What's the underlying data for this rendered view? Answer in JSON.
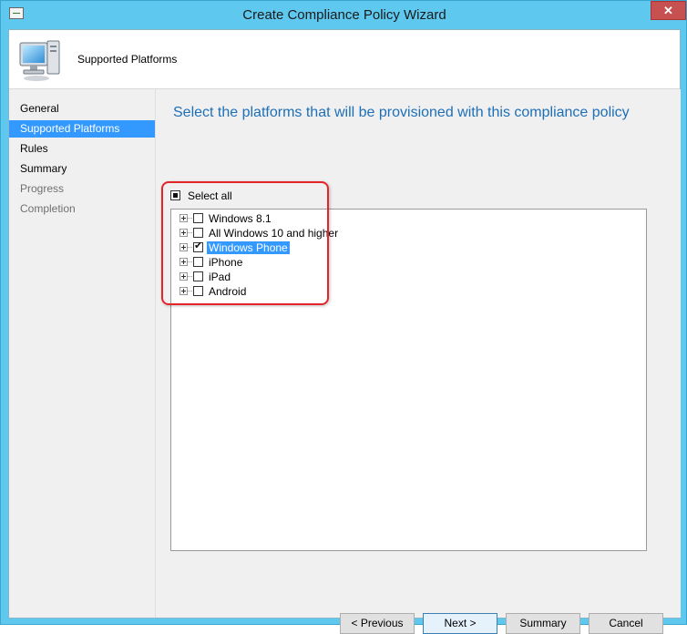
{
  "window": {
    "title": "Create Compliance Policy Wizard",
    "close_glyph": "✕"
  },
  "banner": {
    "title": "Supported Platforms",
    "icon": "computer-icon"
  },
  "nav": {
    "items": [
      {
        "label": "General",
        "state": "normal"
      },
      {
        "label": "Supported Platforms",
        "state": "active"
      },
      {
        "label": "Rules",
        "state": "normal"
      },
      {
        "label": "Summary",
        "state": "normal"
      },
      {
        "label": "Progress",
        "state": "disabled"
      },
      {
        "label": "Completion",
        "state": "disabled"
      }
    ]
  },
  "main": {
    "heading": "Select the platforms that will be provisioned with this compliance policy",
    "select_all": {
      "label": "Select all",
      "state": "indeterminate"
    },
    "platforms": [
      {
        "label": "Windows 8.1",
        "checked": false,
        "selected": false
      },
      {
        "label": "All Windows 10 and higher",
        "checked": false,
        "selected": false
      },
      {
        "label": "Windows Phone",
        "checked": true,
        "selected": true
      },
      {
        "label": "iPhone",
        "checked": false,
        "selected": false
      },
      {
        "label": "iPad",
        "checked": false,
        "selected": false
      },
      {
        "label": "Android",
        "checked": false,
        "selected": false
      }
    ]
  },
  "buttons": {
    "previous": "< Previous",
    "next": "Next >",
    "summary": "Summary",
    "cancel": "Cancel"
  },
  "colors": {
    "accent": "#3399ff",
    "heading": "#1e6fb6",
    "frame": "#5ec8ef",
    "annotation": "#e3252a"
  }
}
